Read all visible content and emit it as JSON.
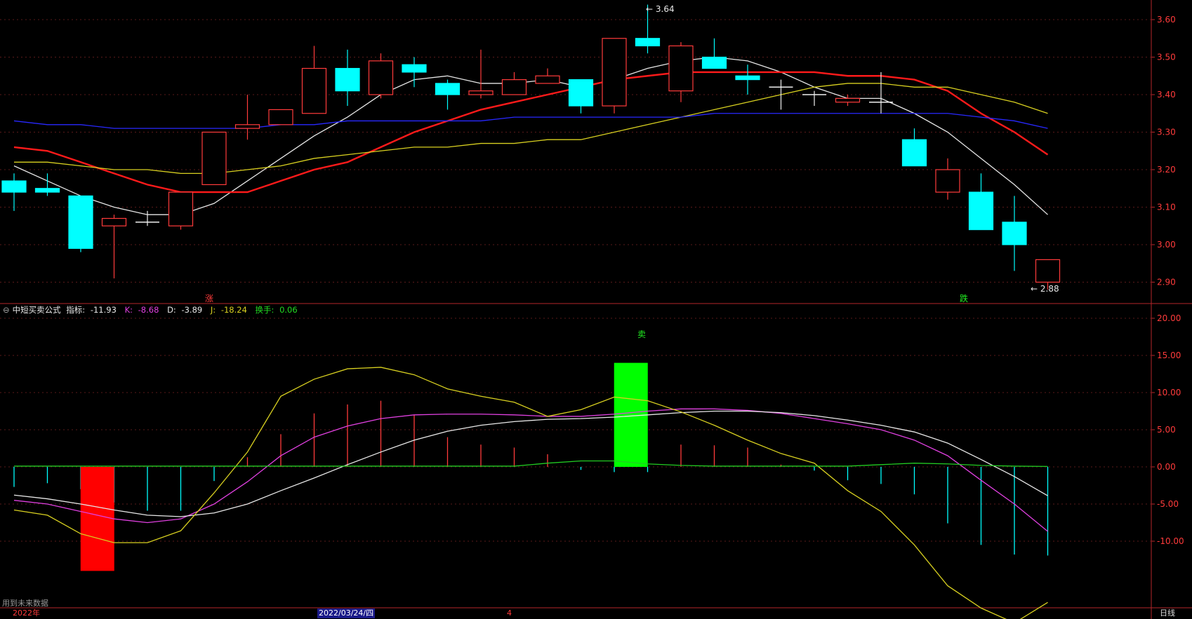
{
  "colors": {
    "bg": "#000000",
    "axis": "#b3262a",
    "grid": "#5a1a1a",
    "up": "#ff3b3b",
    "down": "#00ffff",
    "ma5": "#e6e6e6",
    "ma10": "#ff1a1a",
    "ma20": "#d8d020",
    "ma60": "#2828ff",
    "k": "#e040e0",
    "d": "#e8e8e8",
    "j": "#d8d020",
    "turnover": "#22cc22",
    "buy_bar": "#ff0000",
    "sell_bar": "#00ff00"
  },
  "legend": {
    "formula": "中短买卖公式",
    "indicator_label": "指标:",
    "indicator_value": "-11.93",
    "k_label": "K:",
    "k_value": "-8.68",
    "d_label": "D:",
    "d_value": "-3.89",
    "j_label": "J:",
    "j_value": "-18.24",
    "turnover_label": "换手:",
    "turnover_value": "0.06"
  },
  "annotations": {
    "high_label": "3.64",
    "low_label": "2.88",
    "rise_marker": "涨",
    "fall_marker": "跌",
    "sell_marker": "卖",
    "future_data_note": "用到未来数据"
  },
  "date_axis": {
    "year": "2022年",
    "selected_date": "2022/03/24/四",
    "month": "4",
    "period": "日线"
  },
  "chart_data": [
    {
      "type": "candlestick",
      "title": "",
      "ylim": [
        2.86,
        3.66
      ],
      "y_ticks": [
        "3.60",
        "3.50",
        "3.40",
        "3.30",
        "3.20",
        "3.10",
        "3.00",
        "2.90"
      ],
      "ohlc": [
        [
          3.17,
          3.19,
          3.09,
          3.14
        ],
        [
          3.15,
          3.19,
          3.13,
          3.14
        ],
        [
          3.13,
          3.13,
          2.98,
          2.99
        ],
        [
          3.05,
          3.08,
          2.91,
          3.07
        ],
        [
          3.06,
          3.09,
          3.05,
          3.06
        ],
        [
          3.05,
          3.14,
          3.04,
          3.14
        ],
        [
          3.16,
          3.3,
          3.16,
          3.3
        ],
        [
          3.31,
          3.4,
          3.28,
          3.32
        ],
        [
          3.32,
          3.36,
          3.32,
          3.36
        ],
        [
          3.35,
          3.53,
          3.35,
          3.47
        ],
        [
          3.47,
          3.52,
          3.37,
          3.41
        ],
        [
          3.4,
          3.51,
          3.39,
          3.49
        ],
        [
          3.48,
          3.5,
          3.42,
          3.46
        ],
        [
          3.43,
          3.44,
          3.36,
          3.4
        ],
        [
          3.4,
          3.52,
          3.39,
          3.41
        ],
        [
          3.4,
          3.46,
          3.4,
          3.44
        ],
        [
          3.43,
          3.47,
          3.43,
          3.45
        ],
        [
          3.44,
          3.44,
          3.35,
          3.37
        ],
        [
          3.37,
          3.55,
          3.35,
          3.55
        ],
        [
          3.55,
          3.64,
          3.51,
          3.53
        ],
        [
          3.41,
          3.54,
          3.38,
          3.53
        ],
        [
          3.5,
          3.55,
          3.47,
          3.47
        ],
        [
          3.45,
          3.48,
          3.4,
          3.44
        ],
        [
          3.42,
          3.44,
          3.36,
          3.42
        ],
        [
          3.4,
          3.41,
          3.37,
          3.4
        ],
        [
          3.38,
          3.4,
          3.37,
          3.39
        ],
        [
          3.38,
          3.46,
          3.35,
          3.38
        ],
        [
          3.28,
          3.31,
          3.21,
          3.21
        ],
        [
          3.14,
          3.23,
          3.12,
          3.2
        ],
        [
          3.14,
          3.19,
          3.04,
          3.04
        ],
        [
          3.06,
          3.13,
          2.93,
          3.0
        ],
        [
          2.9,
          2.93,
          2.88,
          2.96
        ]
      ],
      "series": [
        {
          "values": [
            3.21,
            3.17,
            3.13,
            3.1,
            3.08,
            3.08,
            3.11,
            3.17,
            3.23,
            3.29,
            3.34,
            3.4,
            3.44,
            3.45,
            3.43,
            3.43,
            3.44,
            3.42,
            3.44,
            3.47,
            3.49,
            3.5,
            3.49,
            3.46,
            3.42,
            3.39,
            3.39,
            3.35,
            3.3,
            3.23,
            3.16,
            3.08
          ]
        },
        {
          "values": [
            3.26,
            3.25,
            3.22,
            3.19,
            3.16,
            3.14,
            3.14,
            3.14,
            3.17,
            3.2,
            3.22,
            3.26,
            3.3,
            3.33,
            3.36,
            3.38,
            3.4,
            3.42,
            3.44,
            3.45,
            3.46,
            3.46,
            3.46,
            3.46,
            3.46,
            3.45,
            3.45,
            3.44,
            3.41,
            3.35,
            3.3,
            3.24
          ]
        },
        {
          "values": [
            3.22,
            3.22,
            3.21,
            3.2,
            3.2,
            3.19,
            3.19,
            3.2,
            3.21,
            3.23,
            3.24,
            3.25,
            3.26,
            3.26,
            3.27,
            3.27,
            3.28,
            3.28,
            3.3,
            3.32,
            3.34,
            3.36,
            3.38,
            3.4,
            3.42,
            3.43,
            3.43,
            3.42,
            3.42,
            3.4,
            3.38,
            3.35
          ]
        },
        {
          "values": [
            3.33,
            3.32,
            3.32,
            3.31,
            3.31,
            3.31,
            3.31,
            3.31,
            3.32,
            3.32,
            3.33,
            3.33,
            3.33,
            3.33,
            3.33,
            3.34,
            3.34,
            3.34,
            3.34,
            3.34,
            3.34,
            3.35,
            3.35,
            3.35,
            3.35,
            3.35,
            3.35,
            3.35,
            3.35,
            3.34,
            3.33,
            3.31
          ]
        }
      ]
    },
    {
      "type": "line",
      "title": "中短买卖公式",
      "ylim": [
        -19,
        22
      ],
      "y_ticks": [
        "20.00",
        "15.00",
        "10.00",
        "5.00",
        "0.00",
        "-5.00",
        "-10.00"
      ],
      "series": [
        {
          "values": [
            -4.5,
            -5.0,
            -6.0,
            -7.0,
            -7.5,
            -7.0,
            -5.0,
            -2.0,
            1.5,
            4.0,
            5.5,
            6.5,
            7.0,
            7.1,
            7.1,
            7.0,
            6.8,
            6.8,
            7.1,
            7.5,
            7.8,
            7.8,
            7.6,
            7.2,
            6.5,
            5.8,
            5.0,
            3.6,
            1.5,
            -1.8,
            -5.0,
            -8.68
          ]
        },
        {
          "values": [
            -3.8,
            -4.3,
            -5.0,
            -5.8,
            -6.5,
            -6.7,
            -6.2,
            -5.0,
            -3.2,
            -1.5,
            0.3,
            2.0,
            3.6,
            4.8,
            5.6,
            6.1,
            6.4,
            6.5,
            6.7,
            7.0,
            7.3,
            7.5,
            7.5,
            7.3,
            6.9,
            6.3,
            5.6,
            4.7,
            3.2,
            1.0,
            -1.3,
            -3.89
          ]
        },
        {
          "values": [
            -5.8,
            -6.5,
            -9.0,
            -10.2,
            -10.2,
            -8.6,
            -3.5,
            2.0,
            9.5,
            11.8,
            13.2,
            13.4,
            12.4,
            10.5,
            9.5,
            8.7,
            6.8,
            7.7,
            9.4,
            8.9,
            7.4,
            5.6,
            3.6,
            1.8,
            0.5,
            -3.2,
            -6.0,
            -10.5,
            -16.0,
            -19.0,
            -21.0,
            -18.24
          ]
        },
        {
          "values": [
            -2.7,
            -2.2,
            -3.0,
            -4.8,
            -5.9,
            -5.9,
            -1.9,
            1.3,
            4.4,
            7.2,
            8.4,
            8.9,
            7.0,
            4.0,
            3.0,
            2.6,
            1.7,
            -0.4,
            -0.7,
            -0.7,
            3.0,
            2.9,
            2.6,
            0.3,
            -0.5,
            -1.8,
            -2.3,
            -3.7,
            -7.6,
            -10.5,
            -11.8,
            -11.93
          ]
        },
        {
          "values": [
            0.1,
            0.1,
            0.1,
            0.1,
            0.1,
            0.1,
            0.1,
            0.1,
            0.1,
            0.1,
            0.1,
            0.1,
            0.1,
            0.1,
            0.1,
            0.1,
            0.5,
            0.8,
            0.8,
            0.4,
            0.2,
            0.1,
            0.1,
            0.1,
            0.1,
            0.1,
            0.3,
            0.5,
            0.4,
            0.2,
            0.1,
            0.06
          ]
        }
      ],
      "signal_bars": [
        {
          "index": 2.5,
          "top": 0,
          "bottom": -14,
          "kind": "buy"
        },
        {
          "index": 18.5,
          "top": 14,
          "bottom": 0,
          "kind": "sell"
        }
      ]
    }
  ]
}
